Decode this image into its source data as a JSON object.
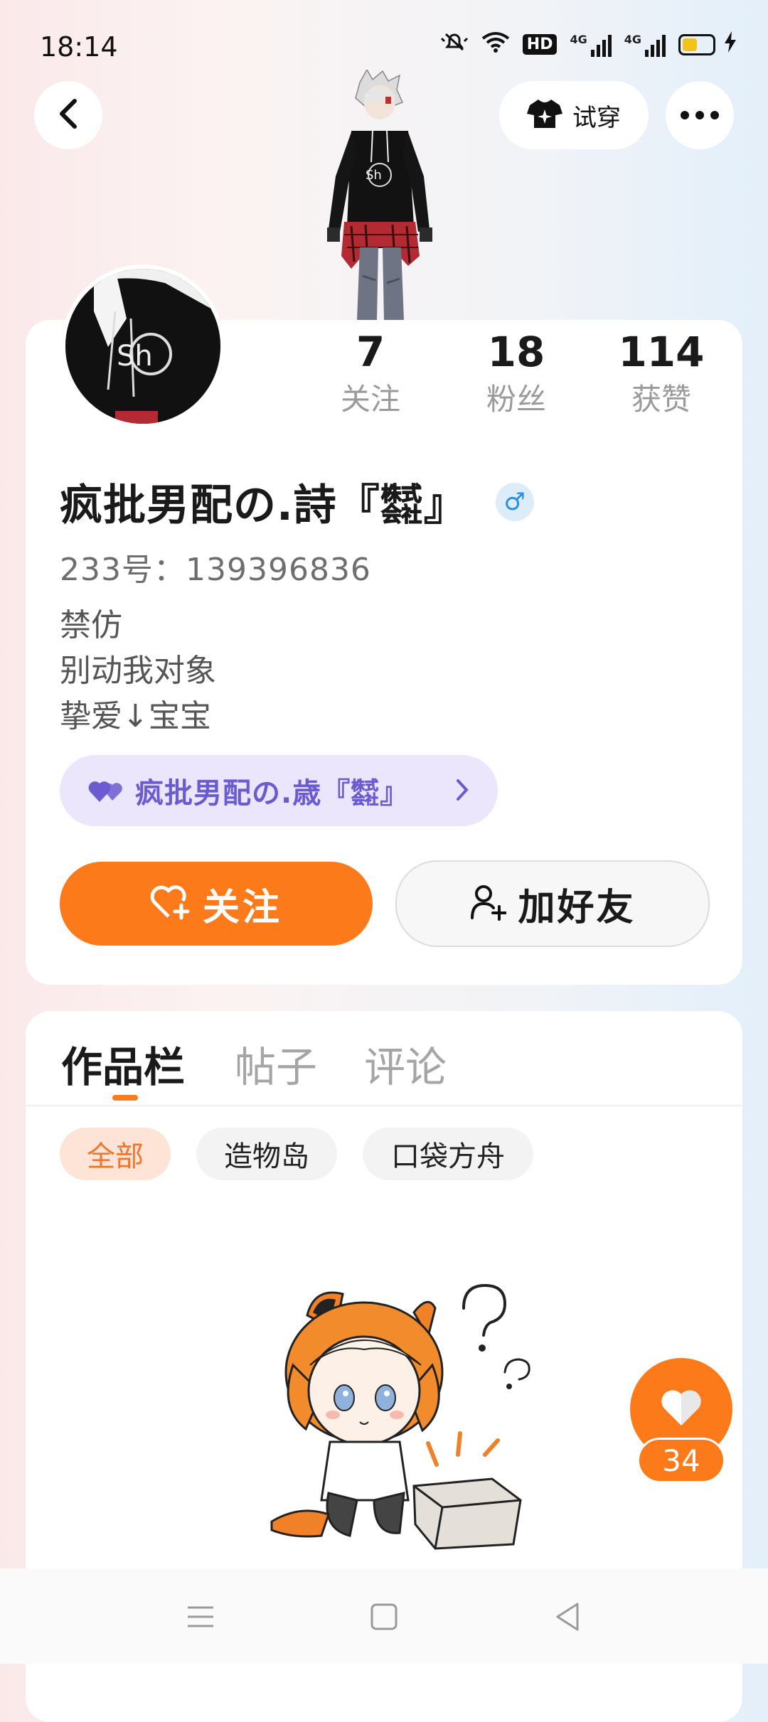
{
  "status_bar": {
    "time": "18:14",
    "hd_label": "HD",
    "net1": "4G",
    "net2": "4G"
  },
  "header": {
    "back_icon": "chevron-left-icon",
    "tryon_label": "试穿",
    "tryon_icon": "tshirt-sparkle-icon",
    "more_icon": "more-dots-icon"
  },
  "profile": {
    "username": "疯批男配の.詩『㍿』",
    "gender": "♂",
    "uid": "233号：139396836",
    "bio": [
      "禁仿",
      "别动我对象",
      "挚爱↓宝宝"
    ],
    "stats": [
      {
        "value": "7",
        "label": "关注"
      },
      {
        "value": "18",
        "label": "粉丝"
      },
      {
        "value": "114",
        "label": "获赞"
      }
    ],
    "partner": {
      "name": "疯批男配の.歳『㍿』",
      "icon": "double-heart-icon"
    },
    "follow_label": "关注",
    "add_friend_label": "加好友"
  },
  "works": {
    "tabs": [
      "作品栏",
      "帖子",
      "评论"
    ],
    "active_tab": 0,
    "filters": [
      "全部",
      "造物岛",
      "口袋方舟"
    ],
    "active_filter": 0
  },
  "like_float": {
    "count": "34",
    "icon": "heart-icon"
  },
  "colors": {
    "accent": "#fd7a1b",
    "partner_bg": "#ebe6fb",
    "partner_text": "#6b5bd0",
    "gender_blue": "#2b8fe0"
  }
}
